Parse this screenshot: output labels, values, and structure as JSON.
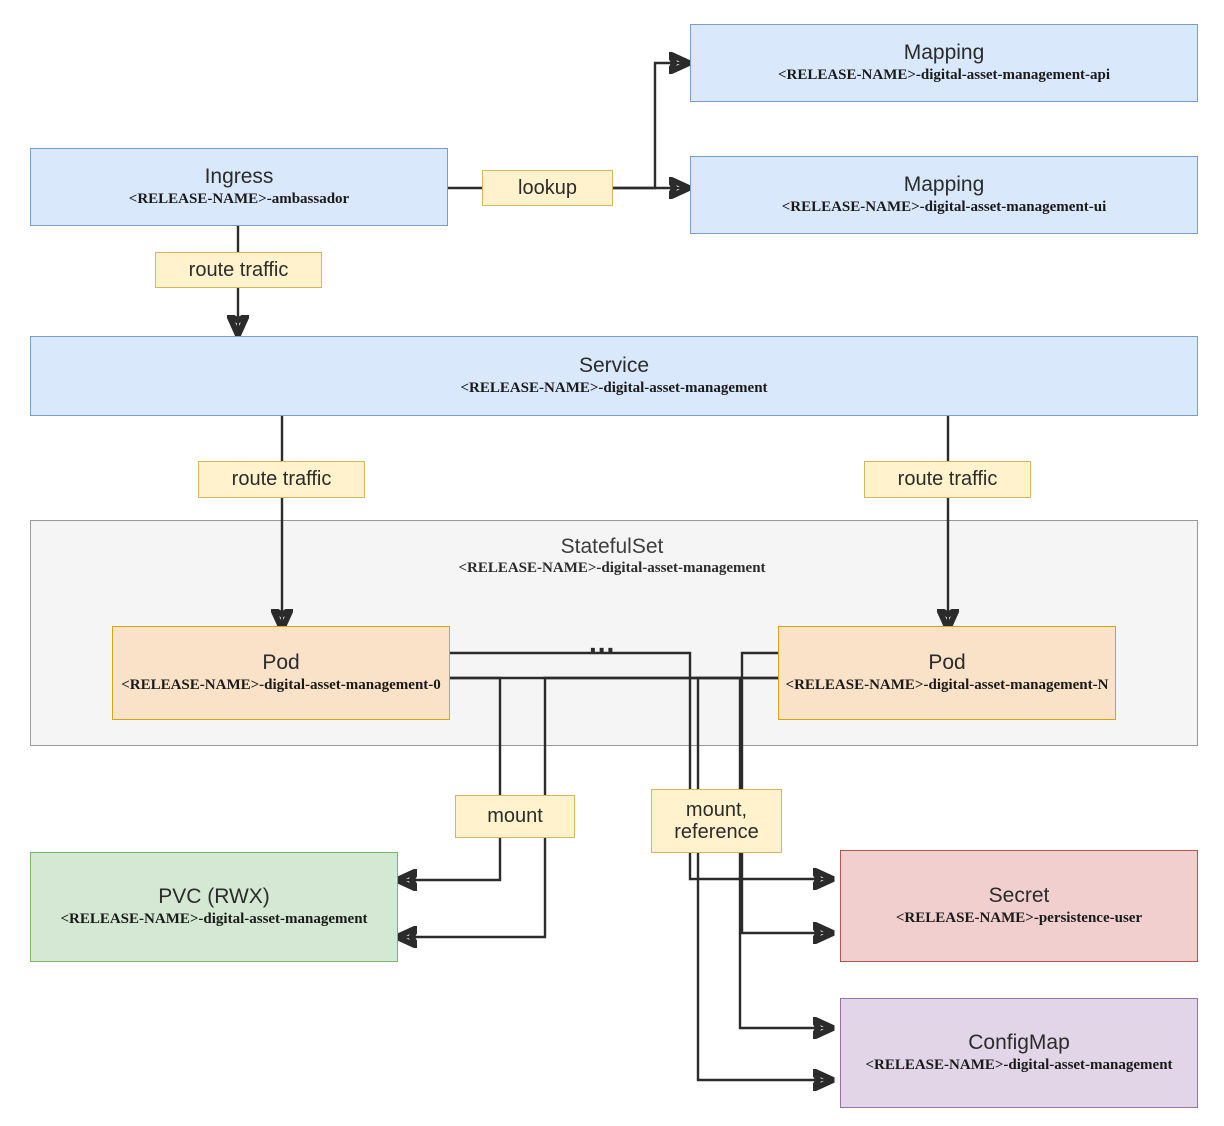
{
  "diagram": {
    "title": "Kubernetes Helm chart resource relationship diagram",
    "release_placeholder": "<RELEASE-NAME>"
  },
  "colors": {
    "resource_blue_fill": "#dae8fc",
    "resource_blue_stroke": "#7a9ccc",
    "pod_orange_fill": "#fae2c8",
    "pod_orange_stroke": "#d6a50f",
    "pvc_green_fill": "#d5e8d4",
    "pvc_green_stroke": "#80b36a",
    "secret_red_fill": "#f0cfce",
    "secret_red_stroke": "#b85450",
    "configmap_purple_fill": "#e1d5e7",
    "configmap_purple_stroke": "#9673a6",
    "group_gray_fill": "#f5f5f5",
    "group_gray_stroke": "#999999",
    "edge_label_fill": "#fff2cc",
    "edge_label_stroke": "#d6b656",
    "edge_line": "#2b2b2b"
  },
  "nodes": {
    "mapping_api": {
      "kind": "Mapping",
      "name": "<RELEASE-NAME>-digital-asset-management-api"
    },
    "mapping_ui": {
      "kind": "Mapping",
      "name": "<RELEASE-NAME>-digital-asset-management-ui"
    },
    "ingress": {
      "kind": "Ingress",
      "name": "<RELEASE-NAME>-ambassador"
    },
    "service": {
      "kind": "Service",
      "name": "<RELEASE-NAME>-digital-asset-management"
    },
    "statefulset": {
      "kind": "StatefulSet",
      "name": "<RELEASE-NAME>-digital-asset-management"
    },
    "pod_0": {
      "kind": "Pod",
      "name": "<RELEASE-NAME>-digital-asset-management-0"
    },
    "pod_n": {
      "kind": "Pod",
      "name": "<RELEASE-NAME>-digital-asset-management-N"
    },
    "pvc": {
      "kind": "PVC (RWX)",
      "name": "<RELEASE-NAME>-digital-asset-management"
    },
    "secret": {
      "kind": "Secret",
      "name": "<RELEASE-NAME>-persistence-user"
    },
    "configmap": {
      "kind": "ConfigMap",
      "name": "<RELEASE-NAME>-digital-asset-management"
    },
    "pod_ellipsis": "..."
  },
  "edge_labels": {
    "lookup": "lookup",
    "route_traffic_ingress": "route traffic",
    "route_traffic_left": "route traffic",
    "route_traffic_right": "route traffic",
    "mount": "mount",
    "mount_reference_line1": "mount,",
    "mount_reference_line2": "reference"
  },
  "edges": [
    {
      "from": "ingress",
      "to": "mapping_api",
      "label": "lookup"
    },
    {
      "from": "ingress",
      "to": "mapping_ui",
      "label": "lookup"
    },
    {
      "from": "ingress",
      "to": "service",
      "label": "route traffic"
    },
    {
      "from": "service",
      "to": "pod_0",
      "label": "route traffic"
    },
    {
      "from": "service",
      "to": "pod_n",
      "label": "route traffic"
    },
    {
      "from": "pod_0",
      "to": "pvc",
      "label": "mount"
    },
    {
      "from": "pod_n",
      "to": "pvc",
      "label": "mount"
    },
    {
      "from": "pod_0",
      "to": "secret",
      "label": "mount, reference"
    },
    {
      "from": "pod_n",
      "to": "secret",
      "label": "mount, reference"
    },
    {
      "from": "pod_0",
      "to": "configmap",
      "label": "mount, reference"
    },
    {
      "from": "pod_n",
      "to": "configmap",
      "label": "mount, reference"
    }
  ]
}
